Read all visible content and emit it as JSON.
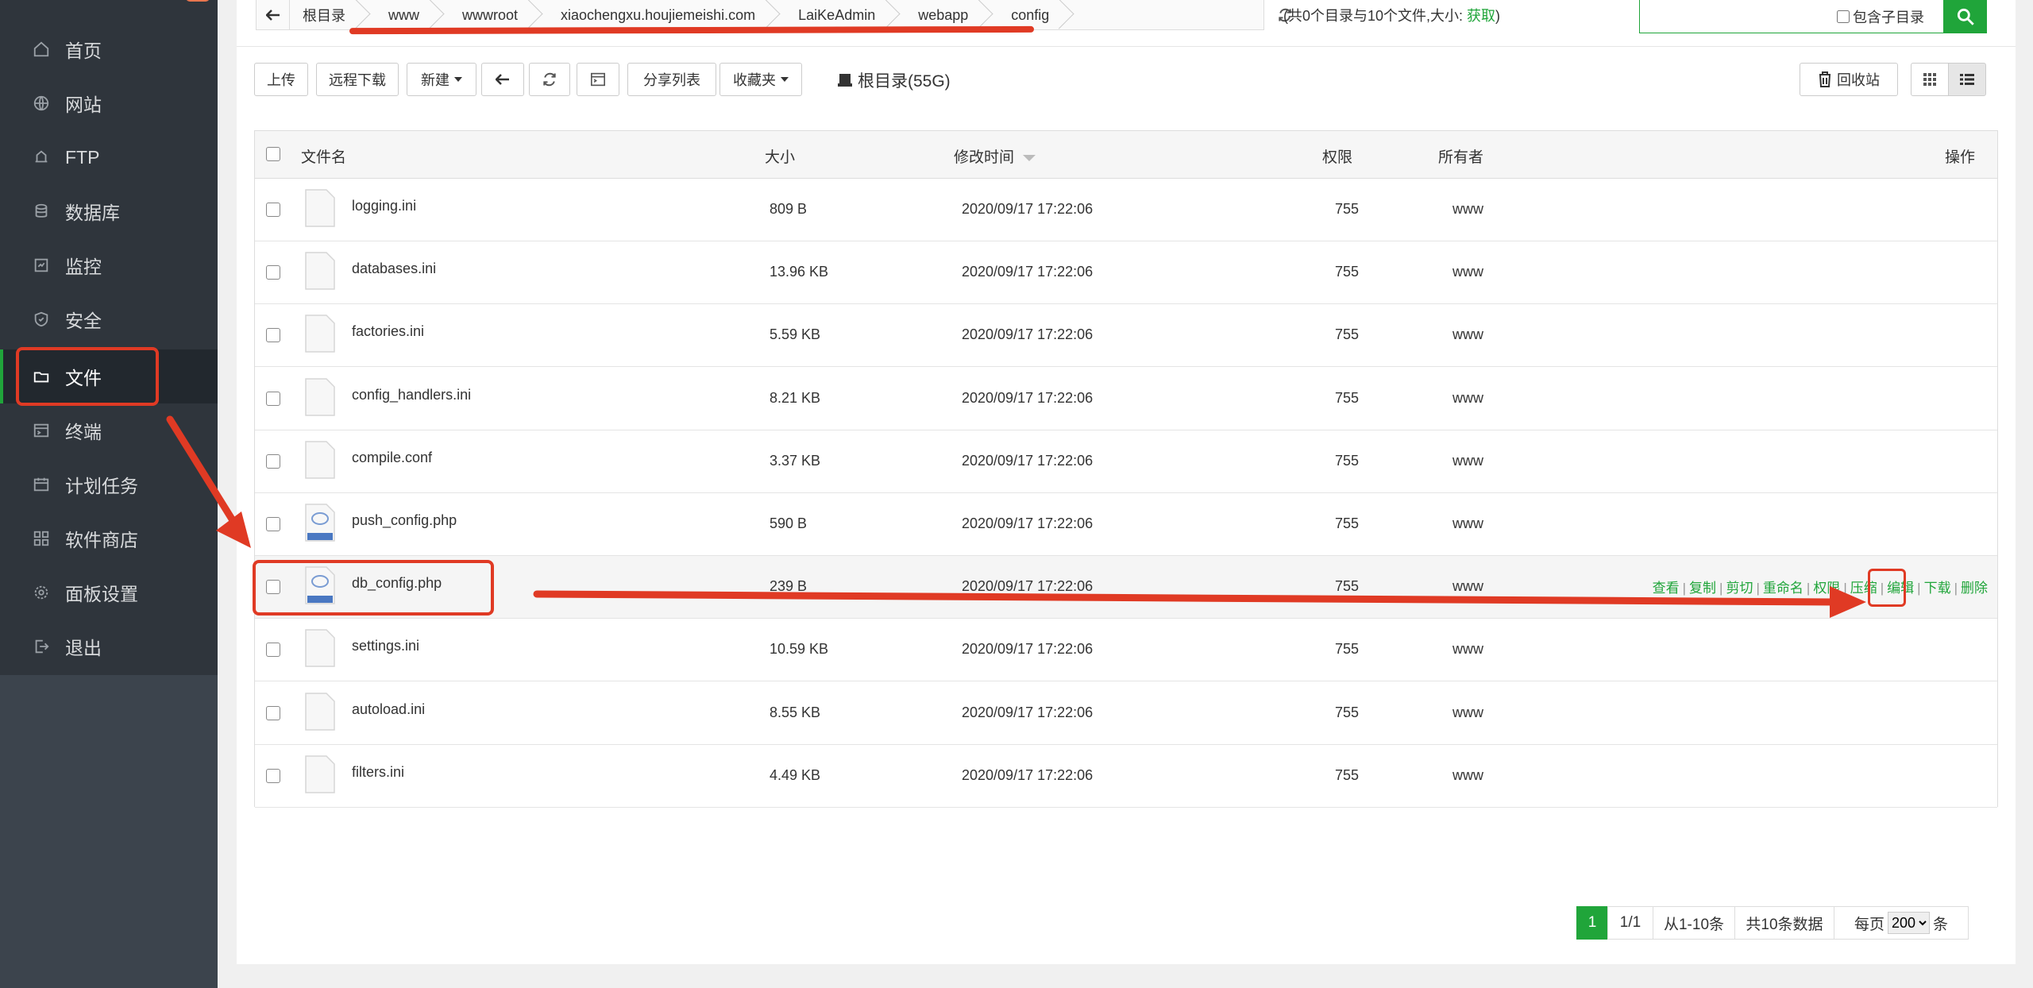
{
  "sidebar": {
    "items": [
      {
        "label": "首页",
        "icon": "home-icon"
      },
      {
        "label": "网站",
        "icon": "globe-icon"
      },
      {
        "label": "FTP",
        "icon": "ftp-icon"
      },
      {
        "label": "数据库",
        "icon": "database-icon"
      },
      {
        "label": "监控",
        "icon": "monitor-icon"
      },
      {
        "label": "安全",
        "icon": "shield-icon"
      },
      {
        "label": "文件",
        "icon": "folder-icon",
        "active": true
      },
      {
        "label": "终端",
        "icon": "terminal-icon"
      },
      {
        "label": "计划任务",
        "icon": "calendar-icon"
      },
      {
        "label": "软件商店",
        "icon": "apps-icon"
      },
      {
        "label": "面板设置",
        "icon": "gear-icon"
      },
      {
        "label": "退出",
        "icon": "logout-icon"
      }
    ]
  },
  "breadcrumb": {
    "items": [
      "根目录",
      "www",
      "wwwroot",
      "xiaochengxu.houjiemeishi.com",
      "LaiKeAdmin",
      "webapp",
      "config"
    ]
  },
  "summary": {
    "text": "(共0个目录与10个文件,大小:",
    "link": "获取",
    "close": ")"
  },
  "search": {
    "include_sub_label": "包含子目录"
  },
  "toolbar": {
    "upload": "上传",
    "remote_download": "远程下载",
    "new": "新建",
    "share_list": "分享列表",
    "favorites": "收藏夹",
    "disk": "根目录(55G)",
    "recycle": "回收站"
  },
  "table": {
    "headers": {
      "name": "文件名",
      "size": "大小",
      "mtime": "修改时间",
      "perm": "权限",
      "owner": "所有者",
      "ops": "操作"
    },
    "rows": [
      {
        "name": "logging.ini",
        "size": "809 B",
        "mtime": "2020/09/17 17:22:06",
        "perm": "755",
        "owner": "www",
        "type": "file"
      },
      {
        "name": "databases.ini",
        "size": "13.96 KB",
        "mtime": "2020/09/17 17:22:06",
        "perm": "755",
        "owner": "www",
        "type": "file"
      },
      {
        "name": "factories.ini",
        "size": "5.59 KB",
        "mtime": "2020/09/17 17:22:06",
        "perm": "755",
        "owner": "www",
        "type": "file"
      },
      {
        "name": "config_handlers.ini",
        "size": "8.21 KB",
        "mtime": "2020/09/17 17:22:06",
        "perm": "755",
        "owner": "www",
        "type": "file"
      },
      {
        "name": "compile.conf",
        "size": "3.37 KB",
        "mtime": "2020/09/17 17:22:06",
        "perm": "755",
        "owner": "www",
        "type": "file"
      },
      {
        "name": "push_config.php",
        "size": "590 B",
        "mtime": "2020/09/17 17:22:06",
        "perm": "755",
        "owner": "www",
        "type": "php"
      },
      {
        "name": "db_config.php",
        "size": "239 B",
        "mtime": "2020/09/17 17:22:06",
        "perm": "755",
        "owner": "www",
        "type": "php",
        "highlight": true
      },
      {
        "name": "settings.ini",
        "size": "10.59 KB",
        "mtime": "2020/09/17 17:22:06",
        "perm": "755",
        "owner": "www",
        "type": "file"
      },
      {
        "name": "autoload.ini",
        "size": "8.55 KB",
        "mtime": "2020/09/17 17:22:06",
        "perm": "755",
        "owner": "www",
        "type": "file"
      },
      {
        "name": "filters.ini",
        "size": "4.49 KB",
        "mtime": "2020/09/17 17:22:06",
        "perm": "755",
        "owner": "www",
        "type": "file"
      }
    ],
    "row_ops": [
      "查看",
      "复制",
      "剪切",
      "重命名",
      "权限",
      "压缩",
      "编辑",
      "下载",
      "删除"
    ]
  },
  "pagination": {
    "current": "1",
    "pages": "1/1",
    "range": "从1-10条",
    "total": "共10条数据",
    "per_page_label": "每页",
    "per_page_value": "200",
    "unit": "条"
  },
  "colors": {
    "accent": "#20a53a",
    "annotation": "#e03a24",
    "sidebar_bg": "#2f353c"
  }
}
